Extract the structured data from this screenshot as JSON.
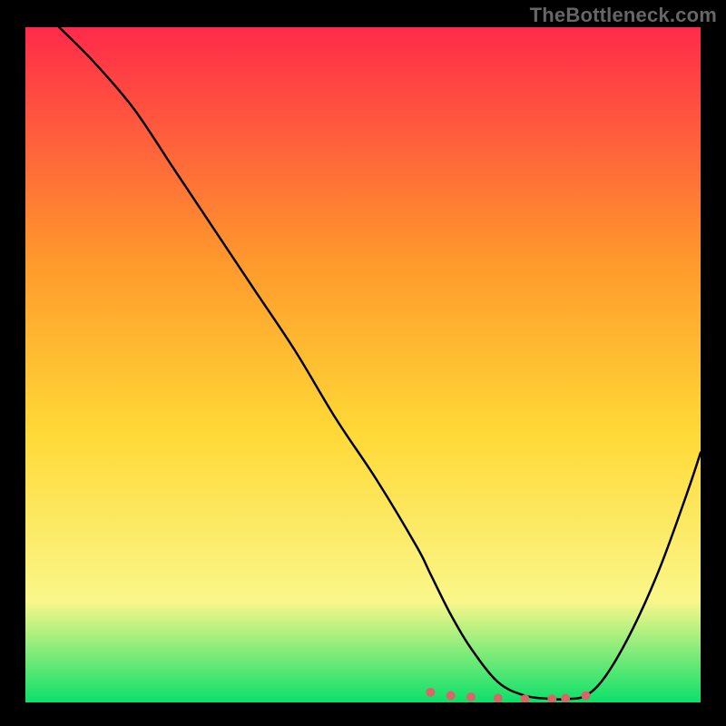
{
  "watermark": "TheBottleneck.com",
  "colors": {
    "frame": "#000000",
    "gradient_top": "#ff2a4a",
    "gradient_upper_mid": "#ff9a2c",
    "gradient_mid": "#ffd936",
    "gradient_lower_mid": "#faf78a",
    "gradient_bottom": "#0be06a",
    "curve_stroke": "#000000",
    "dot_fill": "#d96666",
    "watermark_text": "#666666"
  },
  "chart_data": {
    "type": "line",
    "title": "",
    "xlabel": "",
    "ylabel": "",
    "xlim": [
      0,
      100
    ],
    "ylim": [
      0,
      100
    ],
    "grid": false,
    "legend": false,
    "series": [
      {
        "name": "bottleneck-curve",
        "x": [
          5,
          10,
          16,
          22,
          28,
          34,
          40,
          46,
          52,
          58,
          60,
          63,
          66,
          70,
          74,
          78,
          80,
          83,
          86,
          90,
          94,
          98,
          100
        ],
        "y": [
          100,
          95,
          88,
          79,
          70,
          61,
          52,
          42,
          33,
          23,
          19,
          13,
          8,
          3,
          1,
          0.5,
          0.5,
          1,
          4,
          11,
          20,
          31,
          37
        ]
      }
    ],
    "annotations": [
      {
        "name": "optimal-range-dots",
        "x": [
          60,
          63,
          66,
          70,
          74,
          78,
          80,
          83
        ],
        "y": [
          1.5,
          1,
          0.8,
          0.6,
          0.5,
          0.5,
          0.6,
          1
        ]
      }
    ]
  }
}
